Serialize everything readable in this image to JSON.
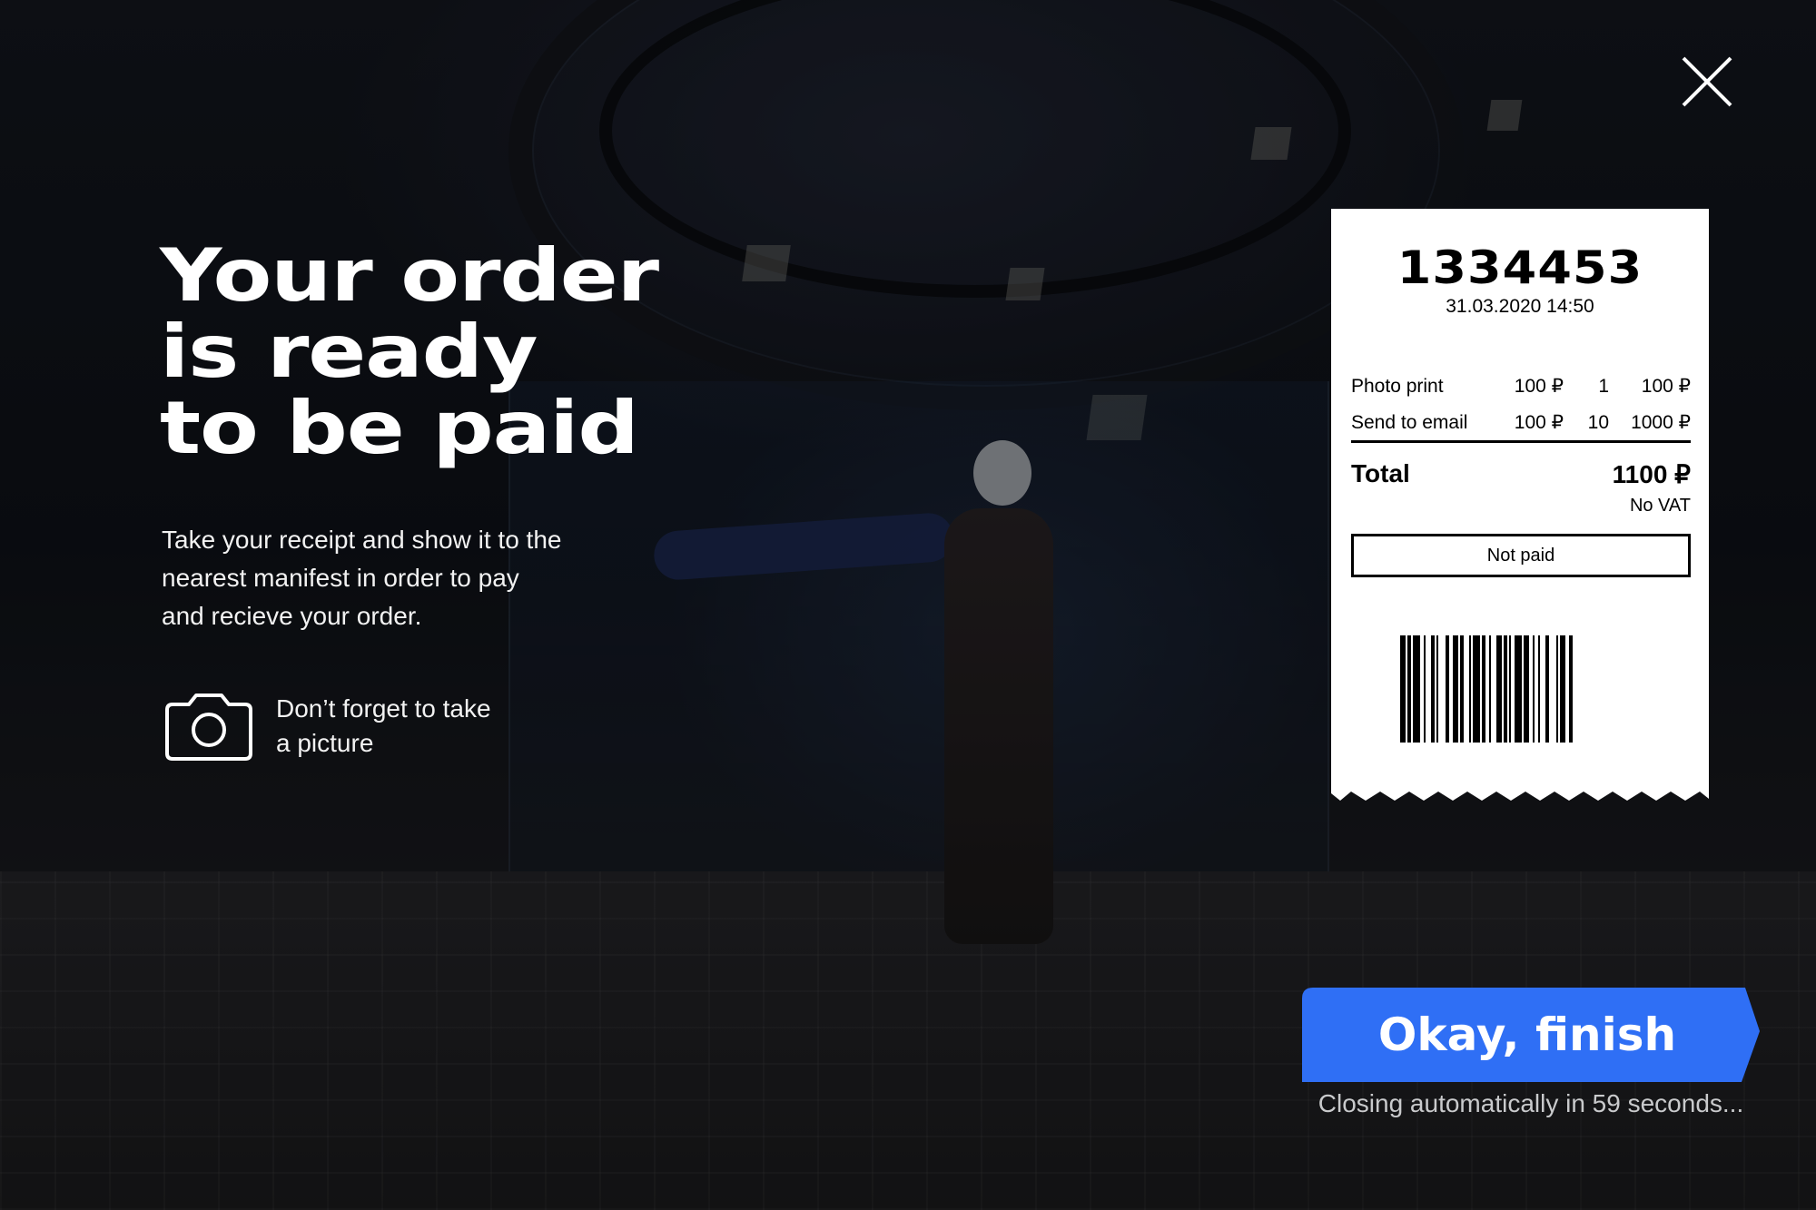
{
  "headline": [
    "Your order",
    "is ready",
    "to be paid"
  ],
  "description": [
    "Take your receipt and show it to the",
    "nearest manifest in order to pay",
    "and recieve your order."
  ],
  "photo_hint": [
    "Don’t forget to take",
    "a picture"
  ],
  "receipt": {
    "order_number": "1334453",
    "datetime": "31.03.2020 14:50",
    "items": [
      {
        "name": "Photo print",
        "price": "100 ₽",
        "qty": "1",
        "sum": "100 ₽"
      },
      {
        "name": "Send to email",
        "price": "100 ₽",
        "qty": "10",
        "sum": "1000 ₽"
      }
    ],
    "total_label": "Total",
    "total_value": "1100 ₽",
    "vat_note": "No VAT",
    "status": "Not paid"
  },
  "finish": {
    "label": "Okay, finish",
    "countdown": "Closing automatically in 59 seconds..."
  },
  "icons": {
    "close": "close-icon",
    "camera": "camera-icon",
    "barcode": "barcode"
  },
  "colors": {
    "accent": "#2f6ff5",
    "receipt_bg": "#ffffff",
    "text": "#ffffff"
  }
}
